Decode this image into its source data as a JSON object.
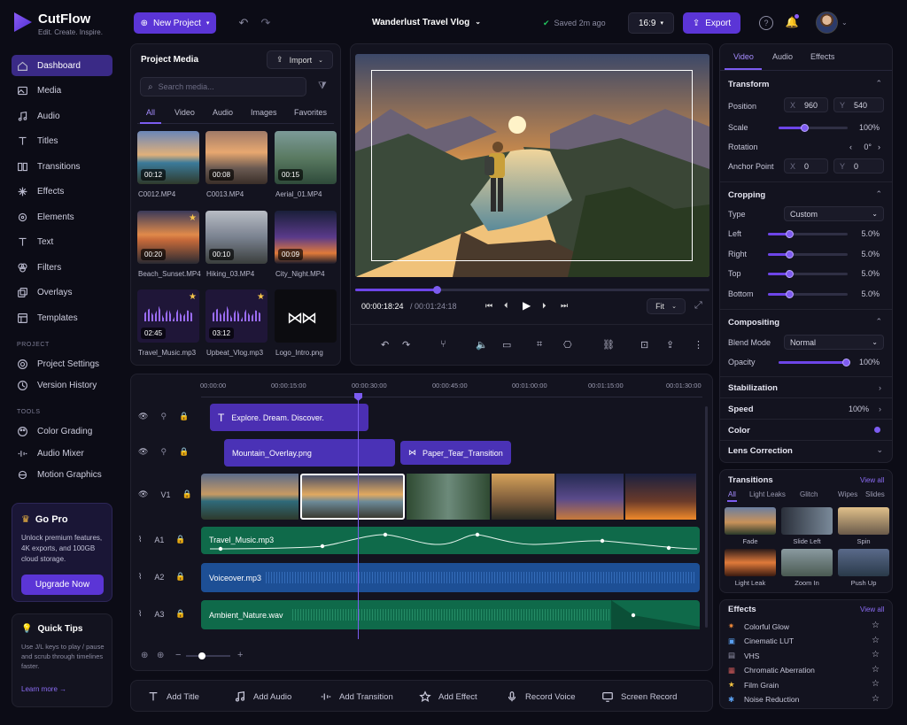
{
  "app": {
    "name": "CutFlow",
    "tagline": "Edit. Create. Inspire."
  },
  "topbar": {
    "new_project": "New Project",
    "project_title": "Wanderlust Travel Vlog",
    "saved": "Saved 2m ago",
    "ratio": "16:9",
    "export": "Export"
  },
  "sidebar": {
    "items": [
      {
        "label": "Dashboard",
        "icon": "home-icon"
      },
      {
        "label": "Media",
        "icon": "image-icon"
      },
      {
        "label": "Audio",
        "icon": "music-icon"
      },
      {
        "label": "Titles",
        "icon": "title-icon"
      },
      {
        "label": "Transitions",
        "icon": "transition-icon"
      },
      {
        "label": "Effects",
        "icon": "sparkle-icon"
      },
      {
        "label": "Elements",
        "icon": "elements-icon"
      },
      {
        "label": "Text",
        "icon": "text-icon"
      },
      {
        "label": "Filters",
        "icon": "filter-icon"
      },
      {
        "label": "Overlays",
        "icon": "overlay-icon"
      },
      {
        "label": "Templates",
        "icon": "template-icon"
      }
    ],
    "project_heading": "PROJECT",
    "project_items": [
      "Project Settings",
      "Version History"
    ],
    "tools_heading": "TOOLS",
    "tools_items": [
      "Color Grading",
      "Audio Mixer",
      "Motion Graphics"
    ],
    "pro": {
      "title": "Go Pro",
      "text": "Unlock premium features, 4K exports, and 100GB cloud storage.",
      "button": "Upgrade Now"
    },
    "tips": {
      "title": "Quick Tips",
      "text": "Use J/L keys to play / pause and scrub through timelines faster.",
      "link": "Learn more →"
    }
  },
  "media": {
    "title": "Project Media",
    "import": "Import",
    "search_placeholder": "Search media...",
    "tabs": [
      "All",
      "Video",
      "Audio",
      "Images",
      "Favorites"
    ],
    "items": [
      {
        "name": "C0012.MP4",
        "duration": "00:12"
      },
      {
        "name": "C0013.MP4",
        "duration": "00:08"
      },
      {
        "name": "Aerial_01.MP4",
        "duration": "00:15"
      },
      {
        "name": "Beach_Sunset.MP4",
        "duration": "00:20"
      },
      {
        "name": "Hiking_03.MP4",
        "duration": "00:10"
      },
      {
        "name": "City_Night.MP4",
        "duration": "00:09"
      },
      {
        "name": "Travel_Music.mp3",
        "duration": "02:45"
      },
      {
        "name": "Upbeat_Vlog.mp3",
        "duration": "03:12"
      },
      {
        "name": "Logo_Intro.png",
        "duration": ""
      }
    ]
  },
  "preview": {
    "current": "00:00:18:24",
    "total": "/ 00:01:24:18",
    "zoom": "Fit",
    "progress": 0.23
  },
  "timeline": {
    "ruler": [
      "00:00:00",
      "00:00:15:00",
      "00:00:30:00",
      "00:00:45:00",
      "00:01:00:00",
      "00:01:15:00",
      "00:01:30:00"
    ],
    "text_clip": "Explore. Dream. Discover.",
    "overlay_clip": "Mountain_Overlay.png",
    "transition_clip": "Paper_Tear_Transition",
    "tracks": {
      "v1": "V1",
      "a1": "A1",
      "a2": "A2",
      "a3": "A3"
    },
    "audio": [
      "Travel_Music.mp3",
      "Voiceover.mp3",
      "Ambient_Nature.wav"
    ]
  },
  "toolbar": [
    "Add Title",
    "Add Audio",
    "Add Transition",
    "Add Effect",
    "Record Voice",
    "Screen Record"
  ],
  "props": {
    "tabs": [
      "Video",
      "Audio",
      "Effects"
    ],
    "transform": {
      "title": "Transform",
      "position": "Position",
      "pos_x": "960",
      "pos_y": "540",
      "scale": "Scale",
      "scale_val": "100%",
      "rotation": "Rotation",
      "rot_val": "0°",
      "anchor": "Anchor Point",
      "anc_x": "0",
      "anc_y": "0",
      "x": "X",
      "y": "Y"
    },
    "cropping": {
      "title": "Cropping",
      "type": "Type",
      "type_val": "Custom",
      "left": "Left",
      "right": "Right",
      "top": "Top",
      "bottom": "Bottom",
      "v": "5.0%"
    },
    "compositing": {
      "title": "Compositing",
      "blend": "Blend Mode",
      "blend_val": "Normal",
      "opacity": "Opacity",
      "opacity_val": "100%"
    },
    "stabilization": "Stabilization",
    "speed": "Speed",
    "speed_val": "100%",
    "color": "Color",
    "lens": "Lens Correction"
  },
  "transitions": {
    "title": "Transitions",
    "view_all": "View all",
    "tabs": [
      "All",
      "Light Leaks",
      "Glitch",
      "Wipes",
      "Slides"
    ],
    "items": [
      "Fade",
      "Slide Left",
      "Spin",
      "Light Leak",
      "Zoom In",
      "Push Up"
    ]
  },
  "effects": {
    "title": "Effects",
    "view_all": "View all",
    "items": [
      "Colorful Glow",
      "Cinematic LUT",
      "VHS",
      "Chromatic Aberration",
      "Film Grain",
      "Noise Reduction"
    ]
  },
  "colors": {
    "accent": "#5b35d6",
    "audio_green": "#0f6a4a",
    "audio_blue": "#1d4f95"
  }
}
